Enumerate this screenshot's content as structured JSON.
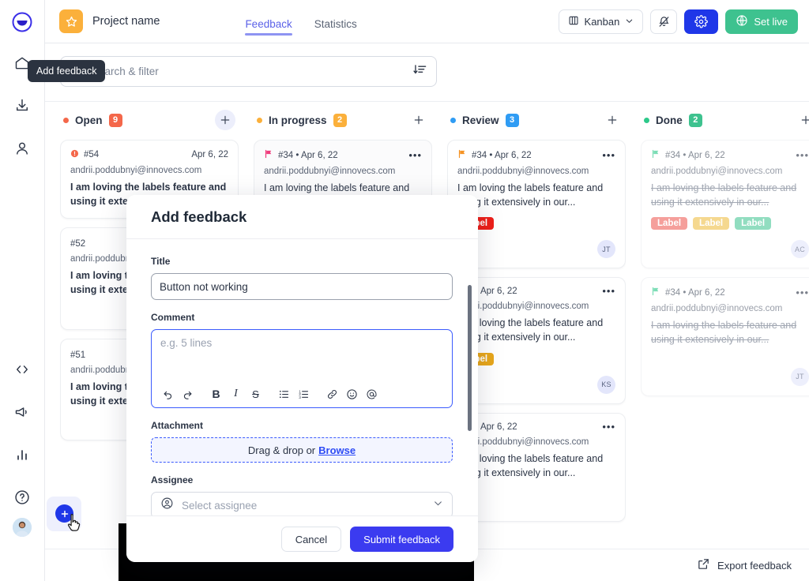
{
  "sidebar": {
    "logo": "logo-icon",
    "items": [
      {
        "icon": "home-icon",
        "name": "home"
      },
      {
        "icon": "download-icon",
        "name": "download"
      },
      {
        "icon": "user-icon",
        "name": "user"
      }
    ],
    "bottom_items": [
      {
        "icon": "code-icon",
        "name": "code"
      },
      {
        "icon": "megaphone-icon",
        "name": "announcements"
      },
      {
        "icon": "bar-chart-icon",
        "name": "analytics"
      },
      {
        "icon": "help-circle-icon",
        "name": "help"
      }
    ]
  },
  "header": {
    "project_badge_icon": "star-icon",
    "project_name": "Project name",
    "tabs": [
      {
        "label": "Feedback",
        "active": true
      },
      {
        "label": "Statistics",
        "active": false
      }
    ],
    "view_switch": {
      "label": "Kanban",
      "icon": "columns-icon",
      "chevron": "chevron-down-icon"
    },
    "notifications_icon": "bell-off-icon",
    "settings_icon": "gear-icon",
    "settings_color": "#1f37e8",
    "set_live": {
      "label": "Set live",
      "icon": "globe-icon",
      "color": "#3ec28f"
    }
  },
  "search": {
    "placeholder": "Search & filter",
    "icon": "search-icon",
    "sort_icon": "sort-descending-icon"
  },
  "board": {
    "columns": [
      {
        "name": "open",
        "title": "Open",
        "count": "9",
        "dot_color": "#f4674a",
        "badge_color": "#f4674a",
        "add_icon": "plus-icon",
        "add_highlight": true,
        "cards": [
          {
            "id": "#54",
            "date": "Apr 6, 22",
            "status_icon": "orange-circle-icon",
            "email": "andrii.poddubnyi@innovecs.com",
            "text": "I am loving the labels feature and using it extensively in our...",
            "bold": true,
            "labels": [],
            "avatar": ""
          },
          {
            "id": "#52",
            "date": "",
            "status_icon": "",
            "email": "andrii.poddubnyi@innovecs.com",
            "text": "I am loving the labels feature and using it extensively in our...",
            "bold": true,
            "labels": [],
            "avatar": ""
          },
          {
            "id": "#51",
            "date": "",
            "status_icon": "",
            "email": "andrii.poddubnyi@innovecs.com",
            "text": "I am loving the labels feature and using it extensively in our...",
            "bold": true,
            "labels": [],
            "avatar": ""
          }
        ]
      },
      {
        "name": "in-progress",
        "title": "In progress",
        "count": "2",
        "dot_color": "#fbb03b",
        "badge_color": "#fbb03b",
        "add_icon": "plus-icon",
        "add_highlight": false,
        "cards": [
          {
            "id": "#34 • Apr 6, 22",
            "date": "",
            "status_icon": "pink-flag-icon",
            "email": "andrii.poddubnyi@innovecs.com",
            "text": "I am loving the labels feature and using it extensively in our...",
            "bold": false,
            "labels": [],
            "avatar": ""
          }
        ]
      },
      {
        "name": "review",
        "title": "Review",
        "count": "3",
        "dot_color": "#2f9cf4",
        "badge_color": "#2f9cf4",
        "add_icon": "plus-icon",
        "add_highlight": false,
        "cards": [
          {
            "id": "#34 • Apr 6, 22",
            "date": "",
            "status_icon": "orange-flag-icon",
            "email": "andrii.poddubnyi@innovecs.com",
            "text": "I am loving the labels feature and using it extensively in our...",
            "bold": false,
            "labels": [
              {
                "text": "Label",
                "color": "#ee1f19"
              }
            ],
            "avatar": "JT"
          },
          {
            "id": "#34 • Apr 6, 22",
            "date": "",
            "status_icon": "",
            "email": "andrii.poddubnyi@innovecs.com",
            "text": "I am loving the labels feature and using it extensively in our...",
            "bold": false,
            "labels": [
              {
                "text": "Label",
                "color": "#e8a71b"
              }
            ],
            "avatar": "KS"
          },
          {
            "id": "#34 • Apr 6, 22",
            "date": "",
            "status_icon": "",
            "email": "andrii.poddubnyi@innovecs.com",
            "text": "I am loving the labels feature and using it extensively in our...",
            "bold": false,
            "labels": [],
            "avatar": ""
          }
        ]
      },
      {
        "name": "done",
        "title": "Done",
        "count": "2",
        "dot_color": "#2dc98a",
        "badge_color": "#3ec28f",
        "add_icon": "plus-icon",
        "add_highlight": false,
        "cards": [
          {
            "id": "#34 • Apr 6, 22",
            "date": "",
            "status_icon": "green-flag-icon",
            "email": "andrii.poddubnyi@innovecs.com",
            "text": "I am loving the labels feature and using it extensively in our...",
            "bold": false,
            "struck": true,
            "labels": [
              {
                "text": "Label",
                "color": "#f0655f"
              },
              {
                "text": "Label",
                "color": "#f0c14b"
              },
              {
                "text": "Label",
                "color": "#4fc99b"
              }
            ],
            "avatar": "AC"
          },
          {
            "id": "#34 • Apr 6, 22",
            "date": "",
            "status_icon": "green-flag-icon",
            "email": "andrii.poddubnyi@innovecs.com",
            "text": "I am loving the labels feature and using it extensively in our...",
            "bold": false,
            "struck": true,
            "labels": [],
            "avatar": "JT"
          }
        ]
      }
    ]
  },
  "bottom_bar": {
    "export_label": "Export feedback",
    "export_icon": "external-link-icon"
  },
  "fab": {
    "icon": "plus-icon",
    "tooltip": "Add feedback",
    "color": "#1f37e8"
  },
  "modal": {
    "title": "Add feedback",
    "title_field": {
      "label": "Title",
      "value": "Button not working"
    },
    "comment_field": {
      "label": "Comment",
      "placeholder": "e.g. 5 lines"
    },
    "toolbar": [
      {
        "name": "undo-icon",
        "glyph": "↶"
      },
      {
        "name": "redo-icon",
        "glyph": "↷"
      },
      {
        "name": "bold-icon",
        "glyph": "B"
      },
      {
        "name": "italic-icon",
        "glyph": "I"
      },
      {
        "name": "strikethrough-icon",
        "glyph": "S"
      },
      {
        "name": "bullet-list-icon",
        "glyph": "☰"
      },
      {
        "name": "numbered-list-icon",
        "glyph": "☷"
      },
      {
        "name": "link-icon",
        "glyph": "🔗"
      },
      {
        "name": "emoji-icon",
        "glyph": "☺"
      },
      {
        "name": "mention-icon",
        "glyph": "@"
      }
    ],
    "attachment": {
      "label": "Attachment",
      "text": "Drag & drop or",
      "browse": "Browse"
    },
    "assignee": {
      "label": "Assignee",
      "placeholder": "Select assignee",
      "icon": "user-circle-icon",
      "chevron": "chevron-down-icon"
    },
    "cancel_label": "Cancel",
    "submit_label": "Submit feedback"
  }
}
